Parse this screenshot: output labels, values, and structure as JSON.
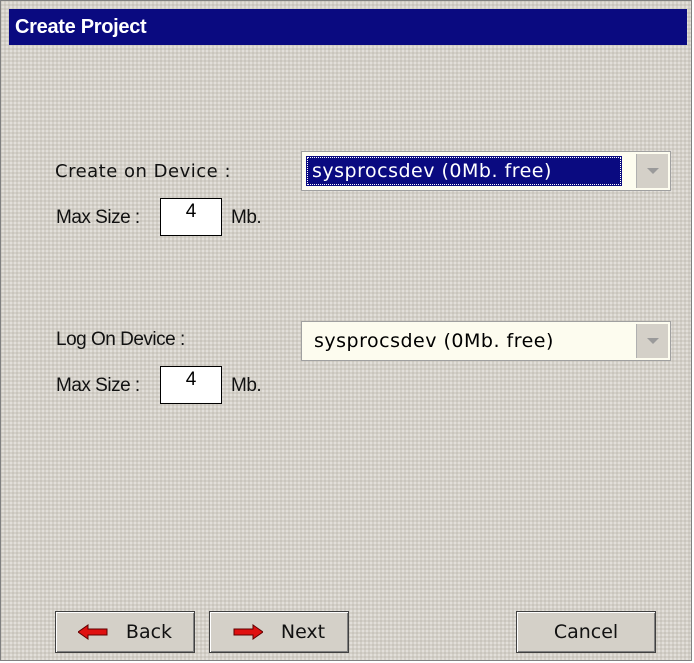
{
  "dialog": {
    "title": "Create Project"
  },
  "data_device": {
    "label": "Create on Device :",
    "selected": "sysprocsdev (0Mb. free)",
    "max_size_label": "Max Size :",
    "max_size_value": "4",
    "unit": "Mb."
  },
  "log_device": {
    "label": "Log On Device :",
    "selected": "sysprocsdev (0Mb. free)",
    "max_size_label": "Max Size :",
    "max_size_value": "4",
    "unit": "Mb."
  },
  "buttons": {
    "back": "Back",
    "next": "Next",
    "cancel": "Cancel"
  },
  "colors": {
    "titlebar": "#0a0a80",
    "selection": "#0a0a80",
    "arrow_red": "#e01010"
  },
  "icons": {
    "back": "arrow-left-icon",
    "next": "arrow-right-icon",
    "dropdown": "chevron-down-icon"
  }
}
